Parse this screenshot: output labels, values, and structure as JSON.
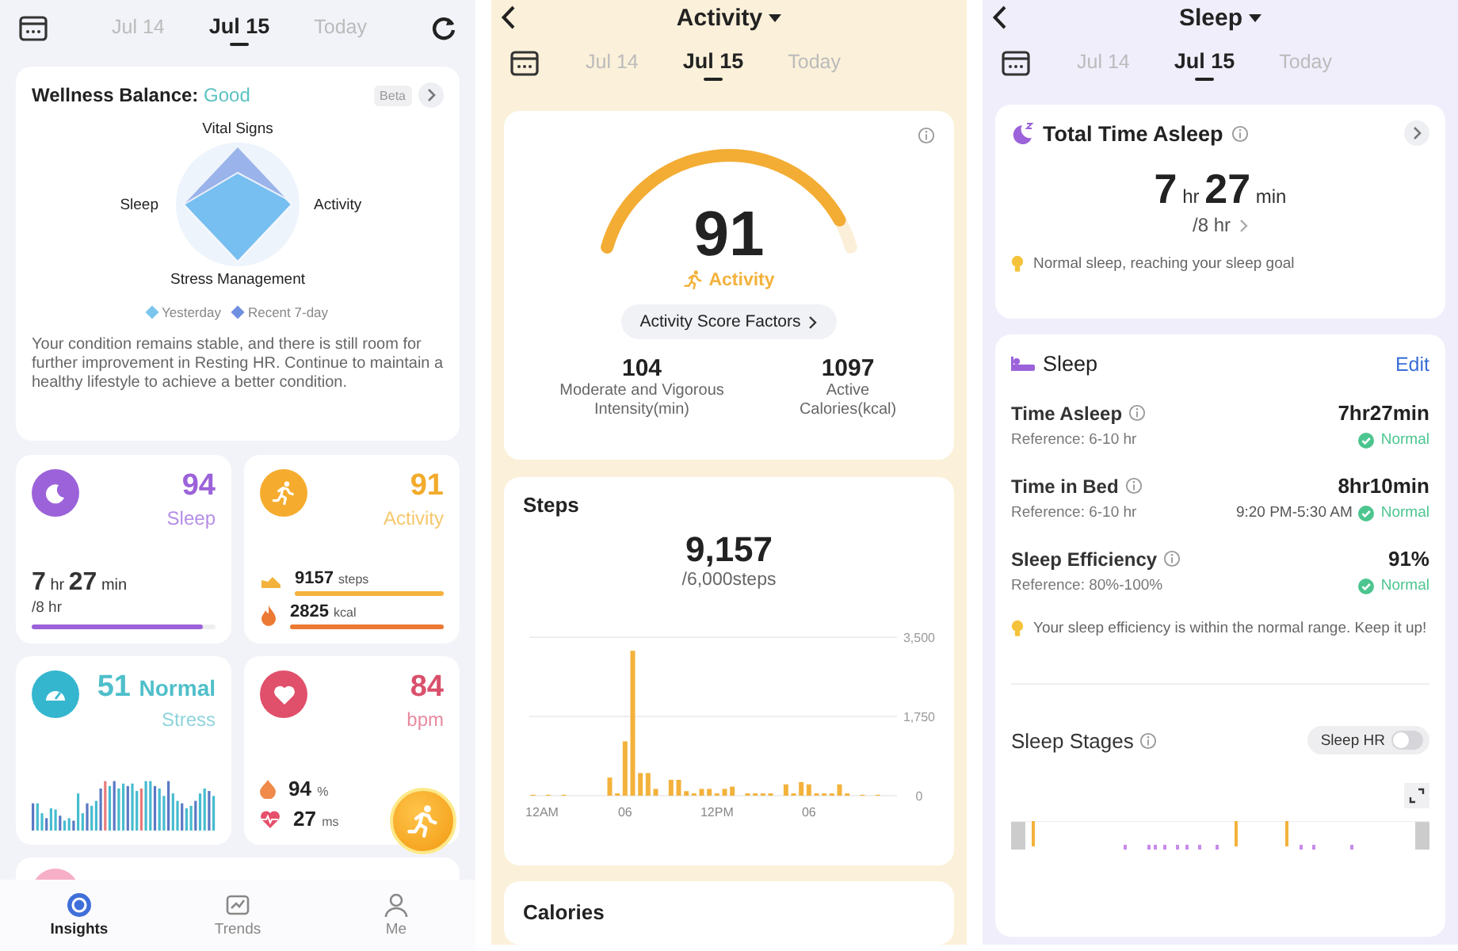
{
  "insights_screen": {
    "date_tabs": [
      {
        "label": "Jul 14",
        "selected": false
      },
      {
        "label": "Jul 15",
        "selected": true
      },
      {
        "label": "Today",
        "selected": false
      }
    ],
    "wellness": {
      "title": "Wellness Balance:",
      "rating": "Good",
      "badge": "Beta",
      "axes": [
        "Vital Signs",
        "Activity",
        "Stress Management",
        "Sleep"
      ],
      "legend": [
        {
          "label": "Yesterday",
          "color": "#7cc6ee"
        },
        {
          "label": "Recent 7-day",
          "color": "#6f8fe0"
        }
      ],
      "summary": "Your condition remains stable, and there is still room for further improvement in Resting HR. Continue to maintain a healthy lifestyle to achieve a better condition."
    },
    "sleep_tile": {
      "score": "94",
      "label": "Sleep",
      "hours": "7",
      "hours_unit": "hr",
      "minutes": "27",
      "minutes_unit": "min",
      "goal": "/8 hr",
      "level": 0.93
    },
    "activity_tile": {
      "score": "91",
      "label": "Activity",
      "metrics": [
        {
          "value": "9157",
          "unit": "steps",
          "level": 1
        },
        {
          "value": "2825",
          "unit": "kcal",
          "level": 1
        }
      ]
    },
    "stress_tile": {
      "score": "51",
      "status": "Normal",
      "label": "Stress"
    },
    "heart_tile": {
      "value": "84",
      "unit": "bpm",
      "metrics": [
        {
          "value": "94",
          "unit": "%"
        },
        {
          "value": "27",
          "unit": "ms"
        }
      ]
    },
    "nav": [
      {
        "label": "Insights",
        "selected": true
      },
      {
        "label": "Trends",
        "selected": false
      },
      {
        "label": "Me",
        "selected": false
      }
    ]
  },
  "activity_screen": {
    "title": "Activity",
    "date_tabs": [
      {
        "label": "Jul 14",
        "selected": false
      },
      {
        "label": "Jul 15",
        "selected": true
      },
      {
        "label": "Today",
        "selected": false
      }
    ],
    "score": {
      "value": "91",
      "label": "Activity",
      "level": 0.91,
      "factors_button": "Activity Score Factors"
    },
    "stats": [
      {
        "value": "104",
        "label": "Moderate and Vigorous Intensity(min)"
      },
      {
        "value": "1097",
        "label": "Active Calories(kcal)"
      }
    ],
    "steps": {
      "title": "Steps",
      "total": "9,157",
      "goal": "/6,000steps",
      "chart_data": {
        "type": "bar",
        "ylim": [
          0,
          3500
        ],
        "yticks": [
          0,
          {
            "value": 1750,
            "label": "1,750"
          },
          {
            "value": 3500,
            "label": "3,500"
          }
        ],
        "values": [
          20,
          0,
          20,
          0,
          20,
          0,
          0,
          0,
          0,
          0,
          400,
          50,
          1200,
          3200,
          500,
          500,
          150,
          0,
          350,
          350,
          100,
          50,
          150,
          150,
          50,
          150,
          200,
          0,
          50,
          50,
          50,
          50,
          0,
          250,
          50,
          300,
          250,
          50,
          50,
          50,
          250,
          50,
          0,
          20,
          0,
          20,
          0,
          0
        ]
      },
      "time_labels": [
        "12AM",
        "06",
        "12PM",
        "06"
      ]
    },
    "calories": {
      "title": "Calories"
    }
  },
  "sleep_screen": {
    "title": "Sleep",
    "date_tabs": [
      {
        "label": "Jul 14",
        "selected": false
      },
      {
        "label": "Jul 15",
        "selected": true
      },
      {
        "label": "Today",
        "selected": false
      }
    ],
    "total": {
      "title": "Total Time Asleep",
      "hours": "7",
      "hours_unit": "hr",
      "minutes": "27",
      "minutes_unit": "min",
      "goal": "/8 hr",
      "tip": "Normal sleep, reaching your sleep goal"
    },
    "details": {
      "title": "Sleep",
      "edit": "Edit",
      "rows": [
        {
          "label": "Time Asleep",
          "value": "7hr27min",
          "reference": "Reference: 6-10 hr",
          "status": "Normal"
        },
        {
          "label": "Time in Bed",
          "value": "8hr10min",
          "reference": "Reference: 6-10 hr",
          "time_range": "9:20 PM-5:30 AM",
          "status": "Normal"
        },
        {
          "label": "Sleep Efficiency",
          "value": "91%",
          "reference": "Reference: 80%-100%",
          "status": "Normal"
        }
      ],
      "tip": "Your sleep efficiency is within the normal range. Keep it up!",
      "stages_title": "Sleep Stages",
      "hr_toggle": {
        "label": "Sleep HR",
        "on": false
      }
    }
  }
}
